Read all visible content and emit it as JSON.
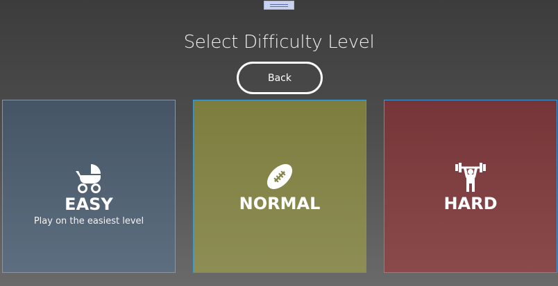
{
  "header": {
    "title": "Select Difficulty Level",
    "back_label": "Back"
  },
  "tiles": [
    {
      "label": "EASY",
      "description": "Play on the easiest level",
      "icon": "baby-stroller-icon",
      "color": "#4f6072"
    },
    {
      "label": "NORMAL",
      "description": "",
      "icon": "football-icon",
      "color": "#85854a"
    },
    {
      "label": "HARD",
      "description": "",
      "icon": "weightlifter-icon",
      "color": "#804043"
    }
  ],
  "colors": {
    "selection_border": "#3c9ad6",
    "handle": "#c9d2ee"
  }
}
